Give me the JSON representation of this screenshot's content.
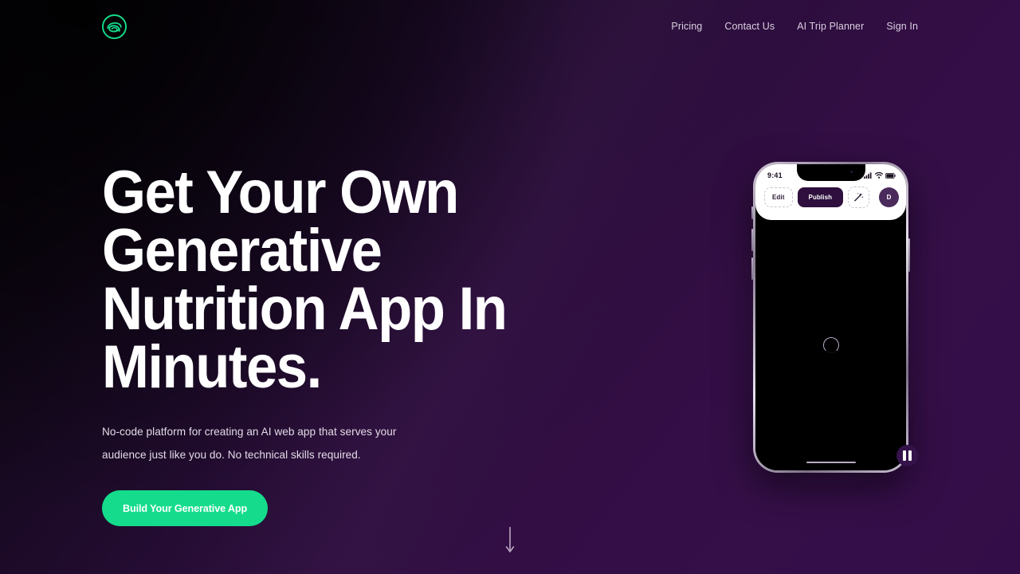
{
  "header": {
    "logo_icon": "spiral-circle-logo",
    "nav": [
      {
        "label": "Pricing"
      },
      {
        "label": "Contact Us"
      },
      {
        "label": "AI Trip Planner"
      },
      {
        "label": "Sign In"
      }
    ]
  },
  "hero": {
    "title": "Get Your Own Generative\nNutrition App In Minutes.",
    "subtitle": "No-code platform for creating an AI web app that serves your\naudience just like you do. No technical skills required.",
    "cta_label": "Build Your Generative App"
  },
  "phone": {
    "status": {
      "time": "9:41",
      "signal_icon": "signal-bars-icon",
      "wifi_icon": "wifi-icon",
      "battery_icon": "battery-icon"
    },
    "actions": {
      "edit_label": "Edit",
      "publish_label": "Publish",
      "magic_icon": "sparkle-wand-icon",
      "avatar_initial": "D"
    },
    "screen": {
      "loading_icon": "loading-spinner-icon"
    },
    "pause_icon": "pause-icon"
  },
  "scroll_hint": {
    "icon": "arrow-down-icon"
  },
  "colors": {
    "accent_green": "#14dc8c",
    "bg_dark": "#0d0610",
    "bg_purple": "#330d47",
    "publish_chip": "#2e0f3d"
  }
}
